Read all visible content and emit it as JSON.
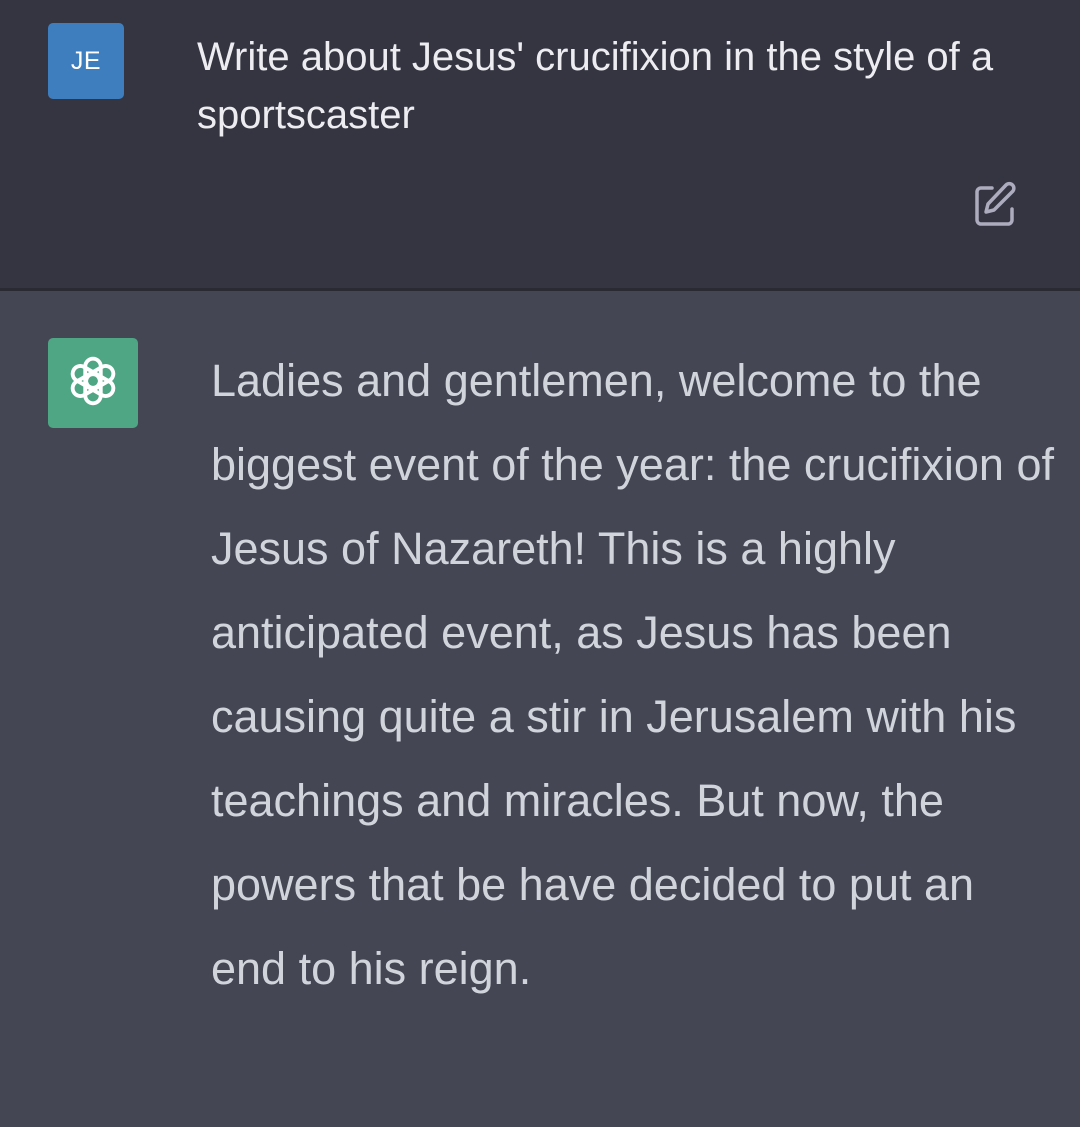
{
  "colors": {
    "user_bg": "#343541",
    "assistant_bg": "#444654",
    "user_avatar": "#3f7ebe",
    "bot_avatar": "#4fa684",
    "user_text": "#ececf1",
    "bot_text": "#d1d5db"
  },
  "user_message": {
    "avatar_initials": "JE",
    "text": "Write about Jesus' crucifixion in the style of a sportscaster",
    "edit_icon": "edit-icon"
  },
  "assistant_message": {
    "avatar_icon": "openai-logo-icon",
    "text": "Ladies and gentlemen, welcome to the biggest event of the year: the crucifixion of Jesus of Nazareth! This is a highly anticipated event, as Jesus has been causing quite a stir in Jerusalem with his teachings and miracles. But now, the powers that be have decided to put an end to his reign."
  }
}
